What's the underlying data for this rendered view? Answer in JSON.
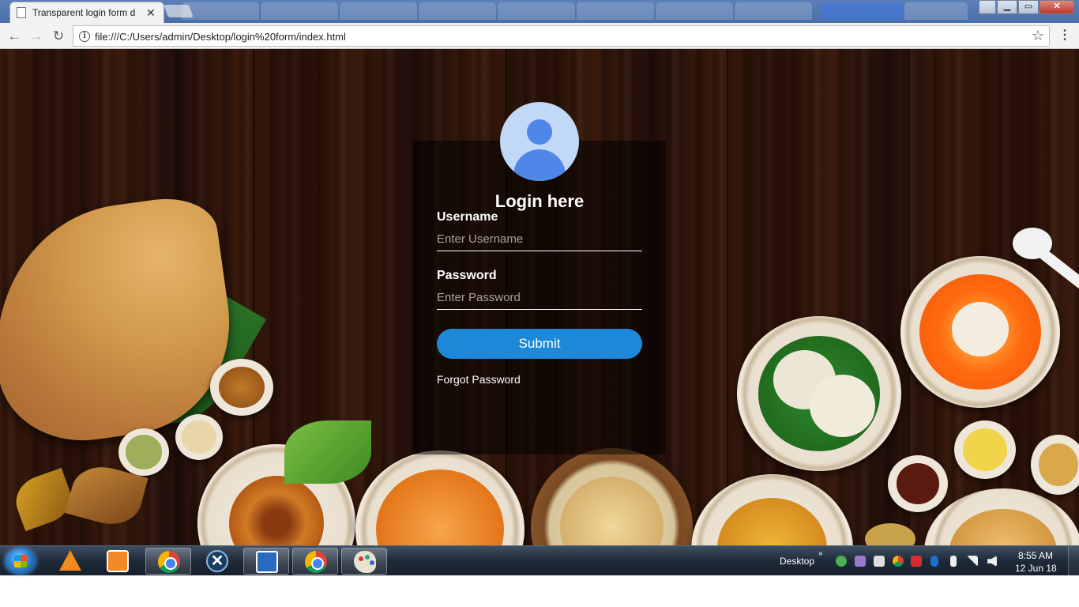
{
  "browser": {
    "tab_title": "Transparent login form d",
    "url": "file:///C:/Users/admin/Desktop/login%20form/index.html",
    "tab_close": "✕",
    "back": "←",
    "forward": "→",
    "reload": "↻",
    "info": "i",
    "star": "☆",
    "menu": "⋮",
    "win_min": "▁",
    "win_max": "▭",
    "win_close": "✕"
  },
  "login": {
    "title": "Login here",
    "username_label": "Username",
    "username_placeholder": "Enter Username",
    "username_value": "",
    "password_label": "Password",
    "password_placeholder": "Enter Password",
    "password_value": "",
    "submit_label": "Submit",
    "forgot_label": "Forgot Password"
  },
  "taskbar": {
    "desktop_label": "Desktop",
    "overflow": "»",
    "clock_time": "8:55 AM",
    "clock_date": "12 Jun 18",
    "x_icon_glyph": "✕"
  },
  "colors": {
    "accent": "#1e88d8",
    "avatar_bg": "#c2d8f7",
    "avatar_fg": "#4f86e8",
    "wood_dark": "#2a1108"
  }
}
